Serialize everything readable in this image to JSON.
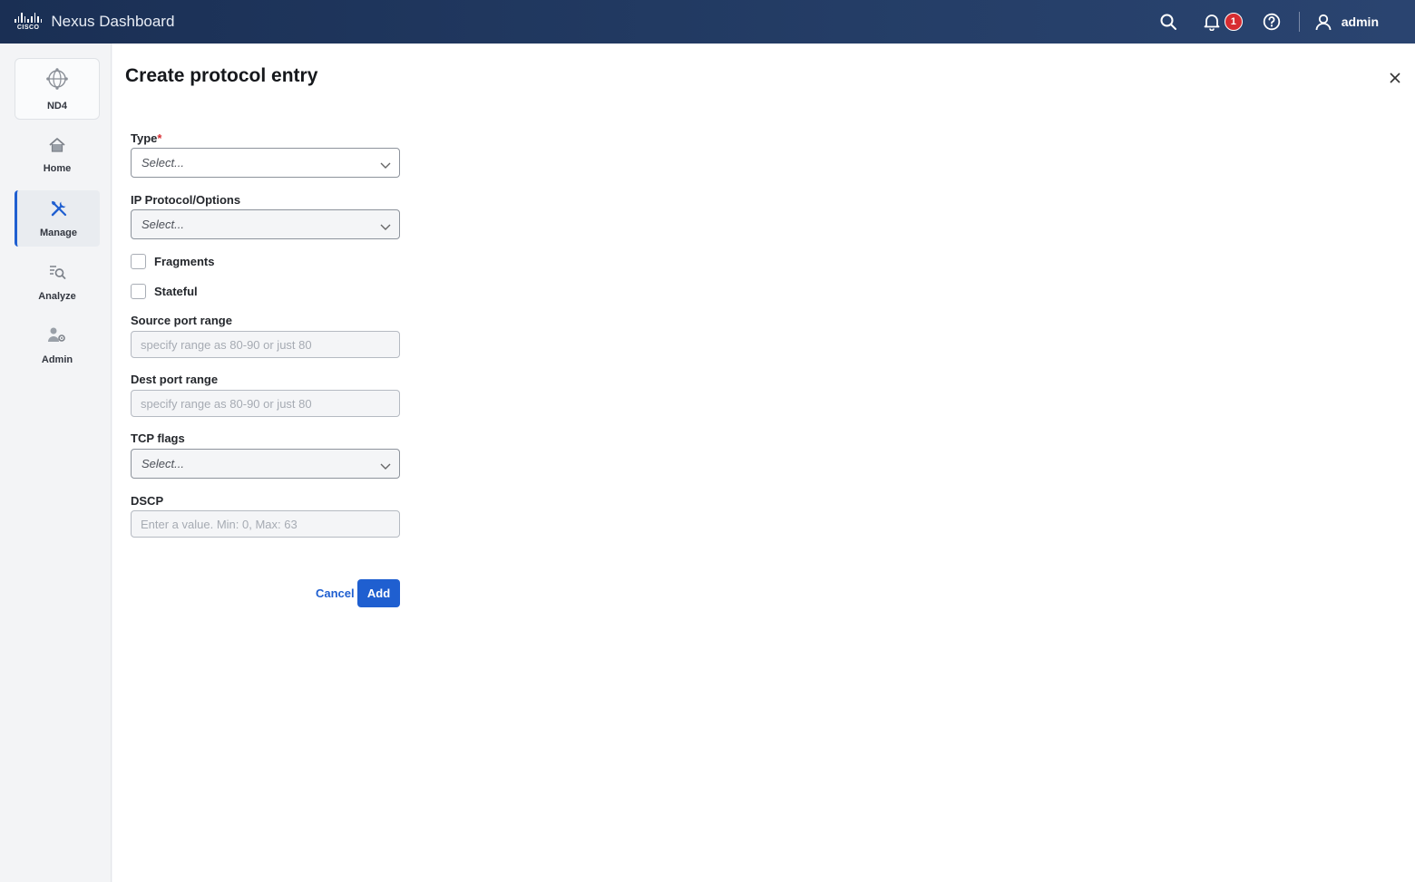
{
  "header": {
    "brand_word": "CISCO",
    "app_title": "Nexus Dashboard",
    "notification_count": "1",
    "user_name": "admin",
    "icons": [
      "search-icon",
      "bell-icon",
      "help-icon",
      "user-icon"
    ],
    "colors": {
      "bar": "#1a2f54",
      "badge": "#d72c31"
    }
  },
  "sidebar": {
    "items": [
      {
        "label": "ND4",
        "icon": "globe-icon",
        "active": false
      },
      {
        "label": "Home",
        "icon": "home-icon",
        "active": false
      },
      {
        "label": "Manage",
        "icon": "tools-icon",
        "active": true
      },
      {
        "label": "Analyze",
        "icon": "analyze-icon",
        "active": false
      },
      {
        "label": "Admin",
        "icon": "admin-icon",
        "active": false
      }
    ],
    "accent": "#1f5fd0"
  },
  "form": {
    "title": "Create protocol entry",
    "type": {
      "label": "Type",
      "required_mark": "*",
      "placeholder": "Select..."
    },
    "ip_protocol": {
      "label": "IP Protocol/Options",
      "placeholder": "Select..."
    },
    "fragments": {
      "label": "Fragments",
      "checked": false
    },
    "stateful": {
      "label": "Stateful",
      "checked": false
    },
    "source_port": {
      "label": "Source port range",
      "placeholder": "specify range as 80-90 or just 80"
    },
    "dest_port": {
      "label": "Dest port range",
      "placeholder": "specify range as 80-90 or just 80"
    },
    "tcp_flags": {
      "label": "TCP flags",
      "placeholder": "Select..."
    },
    "dscp": {
      "label": "DSCP",
      "placeholder": "Enter a value. Min: 0, Max: 63"
    },
    "cancel_label": "Cancel",
    "add_label": "Add"
  }
}
